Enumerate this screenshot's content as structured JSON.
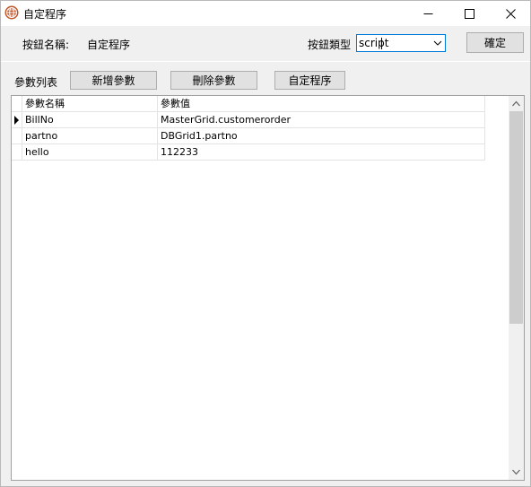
{
  "window": {
    "title": "自定程序",
    "icon": "globe-icon"
  },
  "header": {
    "button_name_label": "按鈕名稱:",
    "button_name_value": "自定程序",
    "button_type_label": "按鈕類型",
    "button_type_value": "script",
    "confirm_label": "確定"
  },
  "params": {
    "list_label": "參數列表",
    "add_label": "新增參數",
    "delete_label": "刪除參數",
    "custom_label": "自定程序"
  },
  "grid": {
    "columns": [
      "參數名稱",
      "參數值"
    ],
    "rows": [
      {
        "name": "BillNo",
        "value": "MasterGrid.customerorder",
        "current": true
      },
      {
        "name": "partno",
        "value": "DBGrid1.partno",
        "current": false
      },
      {
        "name": "hello",
        "value": "112233",
        "current": false
      }
    ]
  },
  "colors": {
    "accent": "#0078d7",
    "button_bg": "#e1e1e1",
    "dialog_bg": "#f0f0f0"
  }
}
